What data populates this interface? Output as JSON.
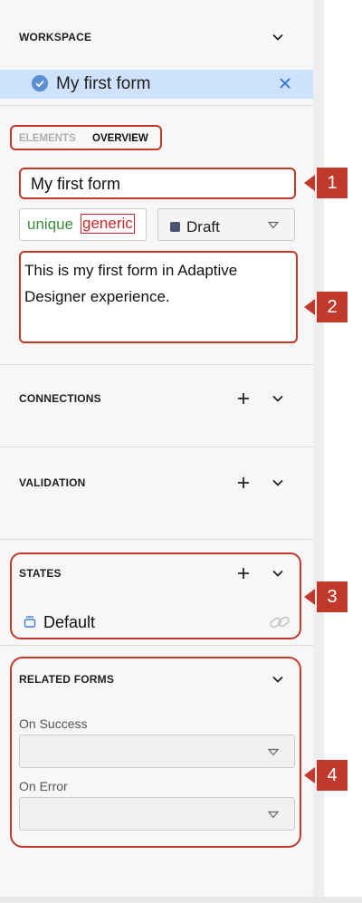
{
  "workspace": {
    "title": "WORKSPACE",
    "selected_item": "My first form"
  },
  "tabs": {
    "elements": "ELEMENTS",
    "overview": "OVERVIEW"
  },
  "overview": {
    "form_name": "My first form",
    "tags": [
      "unique",
      "generic"
    ],
    "status": "Draft",
    "description": "This is my first form in Adaptive Designer experience."
  },
  "sections": {
    "connections": "CONNECTIONS",
    "validation": "VALIDATION",
    "states": "STATES",
    "related_forms": "RELATED FORMS"
  },
  "states": {
    "items": [
      "Default"
    ]
  },
  "related_forms": {
    "on_success_label": "On Success",
    "on_success_value": "",
    "on_error_label": "On Error",
    "on_error_value": ""
  },
  "callouts": [
    "1",
    "2",
    "3",
    "4"
  ],
  "colors": {
    "annotation_red": "#c0392b",
    "selected_bg": "#cfe2fb",
    "accent_blue": "#5a8fd6",
    "tag_green": "#3c8d3c",
    "tag_red": "#c62828"
  },
  "icons": [
    "chevron-down-icon",
    "check-circle-icon",
    "close-icon",
    "plus-icon",
    "caret-down-icon",
    "stack-icon",
    "link-icon"
  ]
}
